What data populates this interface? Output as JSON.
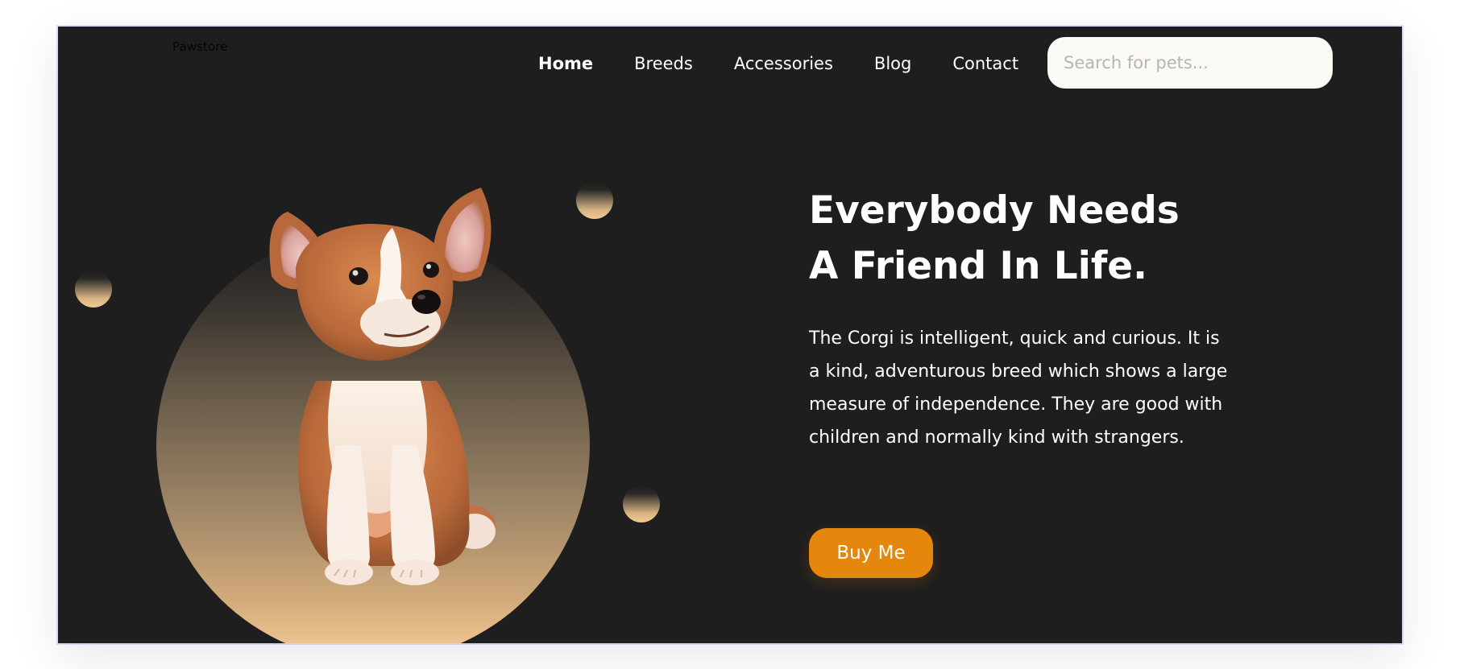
{
  "header": {
    "brand": "Pawstore",
    "nav": {
      "home": "Home",
      "breeds": "Breeds",
      "accessories": "Accessories",
      "blog": "Blog",
      "contact": "Contact"
    },
    "search_placeholder": "Search for pets..."
  },
  "hero": {
    "title_line1": "Everybody Needs",
    "title_line2": "A Friend In Life.",
    "description": "The Corgi is intelligent, quick and curious. It is a kind, adventurous breed which shows a large measure of independence. They are good with children and normally kind with strangers.",
    "cta_label": "Buy Me"
  },
  "colors": {
    "background": "#1e1e1e",
    "accent": "#e5860d",
    "peach": "#f4c98e",
    "search_bg": "#fbfaf5"
  }
}
